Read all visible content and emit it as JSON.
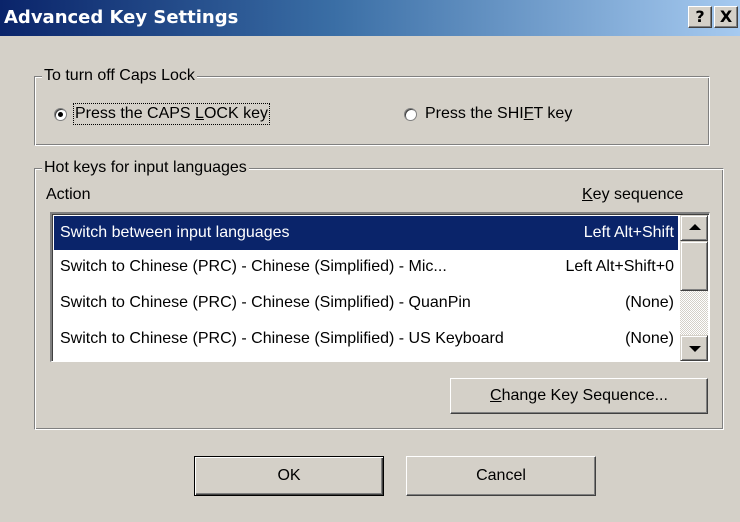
{
  "window": {
    "title": "Advanced Key Settings",
    "help_label": "?",
    "close_label": "X"
  },
  "caps_lock": {
    "legend": "To turn off Caps Lock",
    "options": [
      {
        "label_pre": "Press the CAPS ",
        "mnemonic": "L",
        "label_post": "OCK key",
        "checked": true
      },
      {
        "label_pre": "Press the SHI",
        "mnemonic": "F",
        "label_post": "T key",
        "checked": false
      }
    ]
  },
  "hot_keys": {
    "legend": "Hot keys for input languages",
    "col_action": "Action",
    "col_keyseq_mnemonic": "K",
    "col_keyseq_rest": "ey sequence",
    "rows": [
      {
        "action": "Switch between input languages",
        "keys": "Left Alt+Shift",
        "selected": true
      },
      {
        "action": "Switch to Chinese (PRC) - Chinese (Simplified) - Mic...",
        "keys": "Left Alt+Shift+0",
        "selected": false
      },
      {
        "action": "Switch to Chinese (PRC) - Chinese (Simplified) - QuanPin",
        "keys": "(None)",
        "selected": false
      },
      {
        "action": "Switch to Chinese (PRC) - Chinese (Simplified) - US Keyboard",
        "keys": "(None)",
        "selected": false
      }
    ],
    "change_mnemonic": "C",
    "change_rest": "hange Key Sequence..."
  },
  "buttons": {
    "ok": "OK",
    "cancel": "Cancel"
  }
}
